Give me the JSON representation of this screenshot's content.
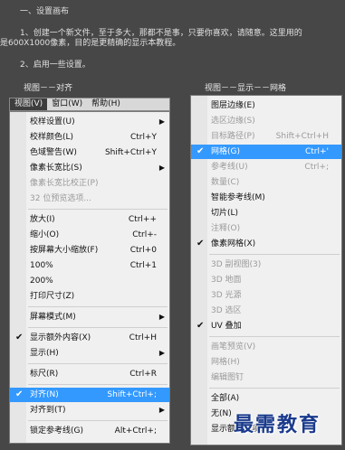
{
  "tutorial": {
    "step1_title": "一、设置画布",
    "step1_line1": "1、创建一个新文件，至于多大，那都不是事，只要你喜欢，请随意。这里用的",
    "step1_line2": "是600X1000像素，目的是更精确的显示本教程。",
    "step2_title": "2、启用一些设置。"
  },
  "left_heading": "视图－－对齐",
  "right_heading": "视图－－显示－－网格",
  "menubar": {
    "items": [
      "视图(V)",
      "窗口(W)",
      "帮助(H)"
    ]
  },
  "view_menu": {
    "items": [
      {
        "label": "校样设置(U)",
        "shortcut": "",
        "arrow": true
      },
      {
        "label": "校样颜色(L)",
        "shortcut": "Ctrl+Y"
      },
      {
        "label": "色域警告(W)",
        "shortcut": "Shift+Ctrl+Y"
      },
      {
        "label": "像素长宽比(S)",
        "shortcut": "",
        "arrow": true
      },
      {
        "label": "像素长宽比校正(P)",
        "shortcut": "",
        "disabled": true
      },
      {
        "label": "32 位预览选项...",
        "shortcut": "",
        "disabled": true
      },
      {
        "label": "放大(I)",
        "shortcut": "Ctrl++"
      },
      {
        "label": "缩小(O)",
        "shortcut": "Ctrl+-"
      },
      {
        "label": "按屏幕大小缩放(F)",
        "shortcut": "Ctrl+0"
      },
      {
        "label": "100%",
        "shortcut": "Ctrl+1"
      },
      {
        "label": "200%",
        "shortcut": ""
      },
      {
        "label": "打印尺寸(Z)",
        "shortcut": ""
      },
      {
        "label": "屏幕模式(M)",
        "shortcut": "",
        "arrow": true
      },
      {
        "label": "显示额外内容(X)",
        "shortcut": "Ctrl+H",
        "checked": true
      },
      {
        "label": "显示(H)",
        "shortcut": "",
        "arrow": true
      },
      {
        "label": "标尺(R)",
        "shortcut": "Ctrl+R"
      },
      {
        "label": "对齐(N)",
        "shortcut": "Shift+Ctrl+;",
        "checked": true
      },
      {
        "label": "对齐到(T)",
        "shortcut": "",
        "arrow": true
      },
      {
        "label": "锁定参考线(G)",
        "shortcut": "Alt+Ctrl+;"
      }
    ]
  },
  "show_menu": {
    "items": [
      {
        "label": "图层边缘(E)",
        "shortcut": ""
      },
      {
        "label": "选区边缘(S)",
        "shortcut": "",
        "disabled": true
      },
      {
        "label": "目标路径(P)",
        "shortcut": "Shift+Ctrl+H",
        "disabled": true
      },
      {
        "label": "网格(G)",
        "shortcut": "Ctrl+'",
        "checked": true
      },
      {
        "label": "参考线(U)",
        "shortcut": "Ctrl+;",
        "disabled": true
      },
      {
        "label": "数量(C)",
        "shortcut": "",
        "disabled": true
      },
      {
        "label": "智能参考线(M)",
        "shortcut": ""
      },
      {
        "label": "切片(L)",
        "shortcut": ""
      },
      {
        "label": "注释(O)",
        "shortcut": "",
        "disabled": true
      },
      {
        "label": "像素网格(X)",
        "shortcut": "",
        "checked": true
      },
      {
        "label": "3D 副视图(3)",
        "shortcut": "",
        "disabled": true
      },
      {
        "label": "3D 地面",
        "shortcut": "",
        "disabled": true
      },
      {
        "label": "3D 光源",
        "shortcut": "",
        "disabled": true
      },
      {
        "label": "3D 选区",
        "shortcut": "",
        "disabled": true
      },
      {
        "label": "UV 叠加",
        "shortcut": "",
        "checked": true
      },
      {
        "label": "画笔预览(V)",
        "shortcut": "",
        "disabled": true
      },
      {
        "label": "网格(H)",
        "shortcut": "",
        "disabled": true
      },
      {
        "label": "编辑图钉",
        "shortcut": "",
        "disabled": true
      },
      {
        "label": "全部(A)",
        "shortcut": ""
      },
      {
        "label": "无(N)",
        "shortcut": ""
      },
      {
        "label": "显示额外选项...",
        "shortcut": ""
      }
    ]
  },
  "watermark": "最需教育",
  "colors": {
    "highlight": "#3399ff",
    "background": "#474747",
    "menu_bg": "#f0f0f0"
  }
}
